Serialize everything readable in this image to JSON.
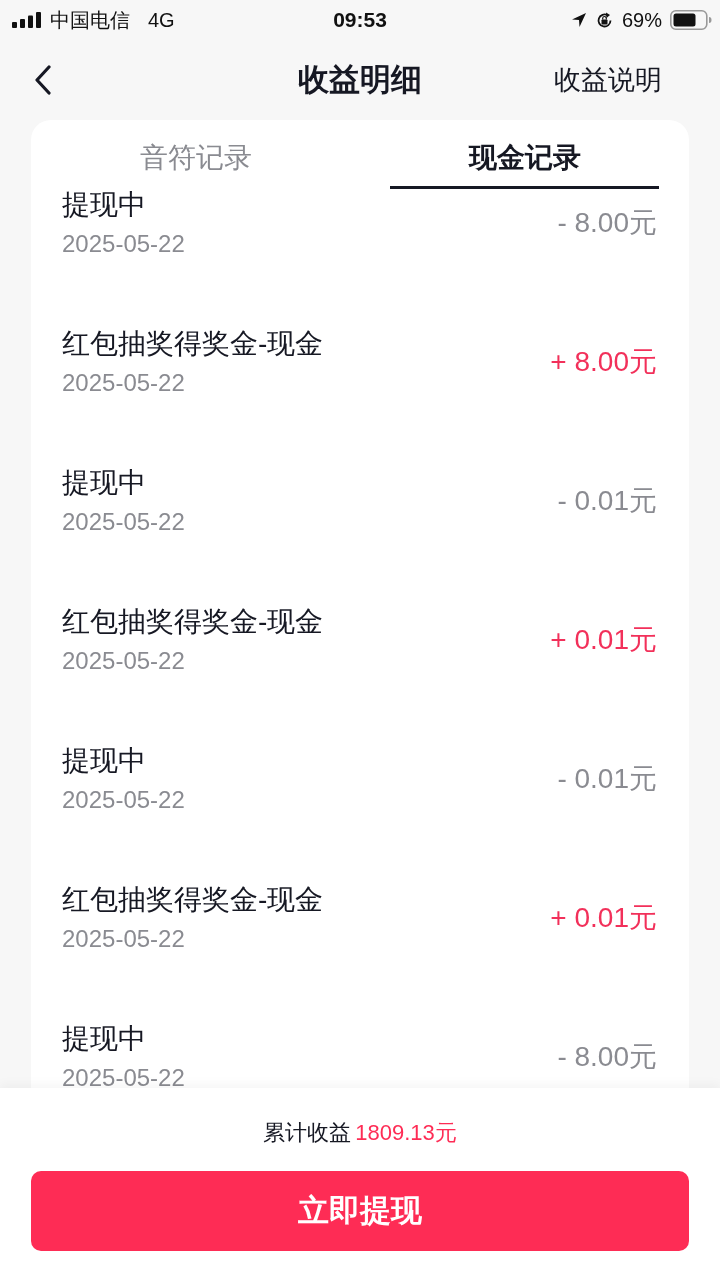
{
  "status_bar": {
    "carrier": "中国电信",
    "network": "4G",
    "time": "09:53",
    "battery": "69%"
  },
  "nav": {
    "title": "收益明细",
    "action": "收益说明"
  },
  "tabs": [
    {
      "label": "音符记录",
      "selected": false
    },
    {
      "label": "现金记录",
      "selected": true
    }
  ],
  "records": [
    {
      "title": "提现中",
      "date": "2025-05-22",
      "amount": "- 8.00元",
      "kind": "expense"
    },
    {
      "title": "红包抽奖得奖金-现金",
      "date": "2025-05-22",
      "amount": "+ 8.00元",
      "kind": "income"
    },
    {
      "title": "提现中",
      "date": "2025-05-22",
      "amount": "- 0.01元",
      "kind": "expense"
    },
    {
      "title": "红包抽奖得奖金-现金",
      "date": "2025-05-22",
      "amount": "+ 0.01元",
      "kind": "income"
    },
    {
      "title": "提现中",
      "date": "2025-05-22",
      "amount": "- 0.01元",
      "kind": "expense"
    },
    {
      "title": "红包抽奖得奖金-现金",
      "date": "2025-05-22",
      "amount": "+ 0.01元",
      "kind": "income"
    },
    {
      "title": "提现中",
      "date": "2025-05-22",
      "amount": "- 8.00元",
      "kind": "expense"
    }
  ],
  "summary": {
    "label": "累计收益",
    "value": "1809.13元"
  },
  "withdraw_button": "立即提现"
}
